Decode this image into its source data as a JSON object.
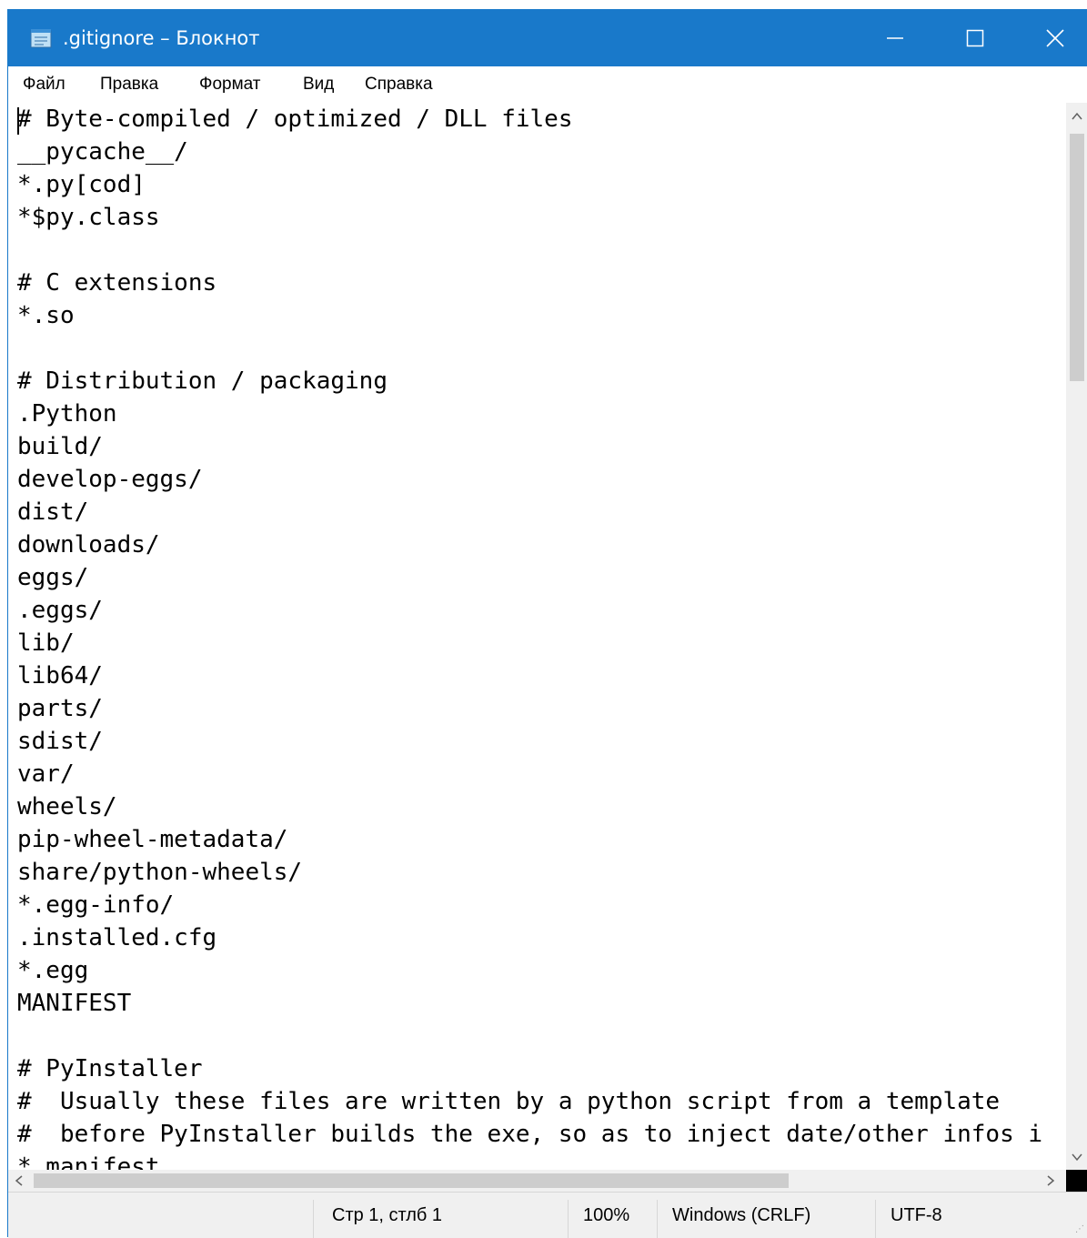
{
  "window": {
    "title": ".gitignore – Блокнот",
    "minimize_glyph": "minimize-icon",
    "maximize_glyph": "maximize-icon",
    "close_glyph": "close-icon"
  },
  "menu": [
    {
      "label": "Файл"
    },
    {
      "label": "Правка"
    },
    {
      "label": "Формат"
    },
    {
      "label": "Вид"
    },
    {
      "label": "Справка"
    }
  ],
  "editor": {
    "content": "# Byte-compiled / optimized / DLL files\n__pycache__/\n*.py[cod]\n*$py.class\n\n# C extensions\n*.so\n\n# Distribution / packaging\n.Python\nbuild/\ndevelop-eggs/\ndist/\ndownloads/\neggs/\n.eggs/\nlib/\nlib64/\nparts/\nsdist/\nvar/\nwheels/\npip-wheel-metadata/\nshare/python-wheels/\n*.egg-info/\n.installed.cfg\n*.egg\nMANIFEST\n\n# PyInstaller\n#  Usually these files are written by a python script from a template\n#  before PyInstaller builds the exe, so as to inject date/other infos i\n*.manifest"
  },
  "status": {
    "position": "Стр 1, стлб 1",
    "zoom": "100%",
    "line_endings": "Windows (CRLF)",
    "encoding": "UTF-8"
  },
  "colors": {
    "titlebar": "#1979ca",
    "statusbar": "#f0f0f0"
  }
}
